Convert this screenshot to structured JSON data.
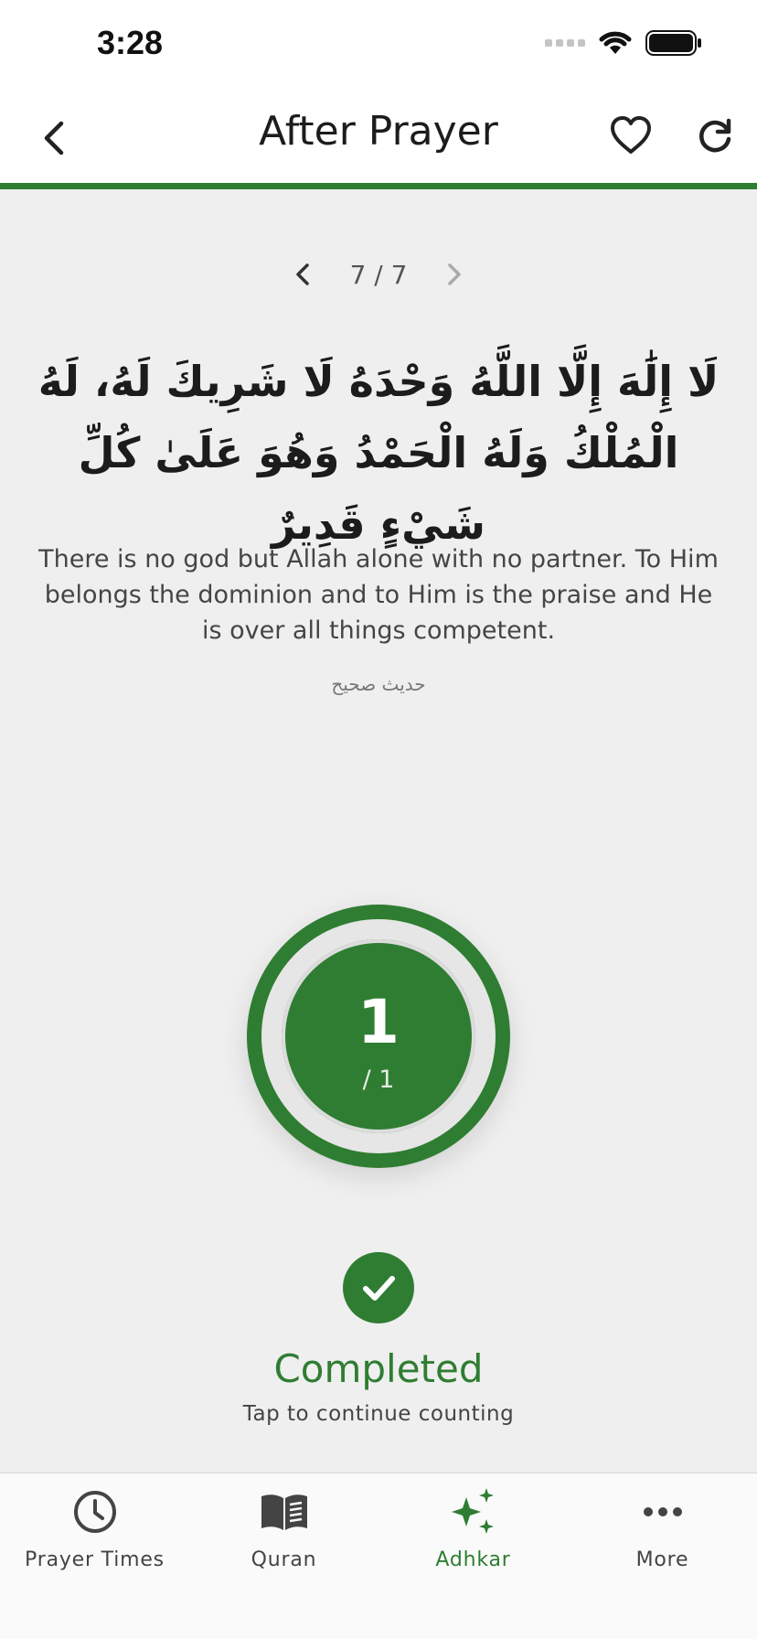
{
  "status_bar": {
    "time": "3:28"
  },
  "header": {
    "title": "After Prayer"
  },
  "pager": {
    "label": "7 / 7"
  },
  "dhikr": {
    "arabic": "لَا إِلَٰهَ إِلَّا اللَّهُ وَحْدَهُ لَا شَرِيكَ لَهُ، لَهُ الْمُلْكُ وَلَهُ الْحَمْدُ وَهُوَ عَلَىٰ كُلِّ شَيْءٍ قَدِيرٌ",
    "translation": "There is no god but Allah alone with no partner. To Him belongs the dominion and to Him is the praise and He is over all things competent.",
    "source": "حديث صحيح"
  },
  "counter": {
    "count": "1",
    "total": "/ 1",
    "progress": 1.0
  },
  "completion": {
    "title": "Completed",
    "hint": "Tap to continue counting"
  },
  "bottom_nav": [
    {
      "label": "Prayer Times",
      "icon": "clock-icon"
    },
    {
      "label": "Quran",
      "icon": "book-icon"
    },
    {
      "label": "Adhkar",
      "icon": "sparkles-icon",
      "active": true
    },
    {
      "label": "More",
      "icon": "more-dots-icon"
    }
  ],
  "colors": {
    "accent": "#2f7d32",
    "background": "#efefef"
  }
}
